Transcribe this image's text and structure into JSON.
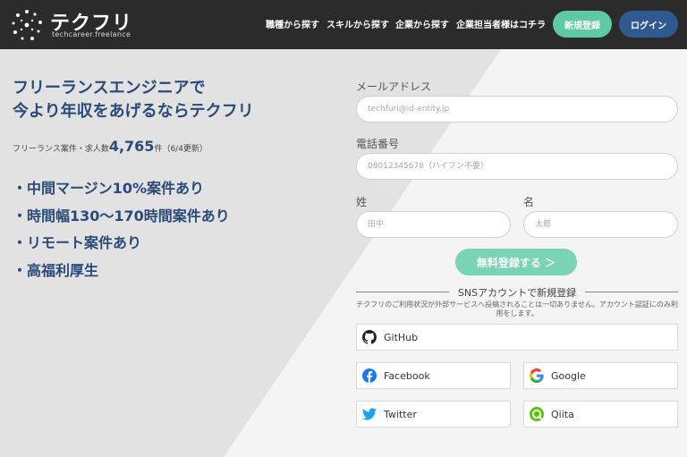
{
  "header": {
    "logo_text": "テクフリ",
    "logo_sub": "techcareer.freelance",
    "nav": [
      "職種から探す",
      "スキルから探す",
      "企業から探す",
      "企業担当者様はコチラ"
    ],
    "register_label": "新規登録",
    "login_label": "ログイン"
  },
  "hero": {
    "headline_1": "フリーランスエンジニアで",
    "headline_2": "今より年収をあげるならテクフリ",
    "count_prefix": "フリーランス案件・求人数",
    "count_value": "4,765",
    "count_suffix": "件（6/4更新）",
    "features": [
      "・中間マージン10%案件あり",
      "・時間幅130〜170時間案件あり",
      "・リモート案件あり",
      "・高福利厚生"
    ]
  },
  "form": {
    "email_label": "メールアドレス",
    "email_placeholder": "techfuri@id-entity.jp",
    "phone_label": "電話番号",
    "phone_placeholder": "08012345678（ハイフン不要）",
    "lastname_label": "姓",
    "lastname_placeholder": "田中",
    "firstname_label": "名",
    "firstname_placeholder": "太郎",
    "submit_label": "無料登録する ＞"
  },
  "sns": {
    "title": "SNSアカウントで新規登録",
    "note": "テクフリのご利用状況が外部サービスへ投稿されることは一切ありません。アカウント認証にのみ利用をします。",
    "github": "GitHub",
    "facebook": "Facebook",
    "google": "Google",
    "twitter": "Twitter",
    "qiita": "Qiita"
  },
  "colors": {
    "header_bg": "#2b2b2b",
    "accent_green": "#5fc9a6",
    "login_blue": "#2f5a8f",
    "headline_blue": "#2a4a7a"
  }
}
